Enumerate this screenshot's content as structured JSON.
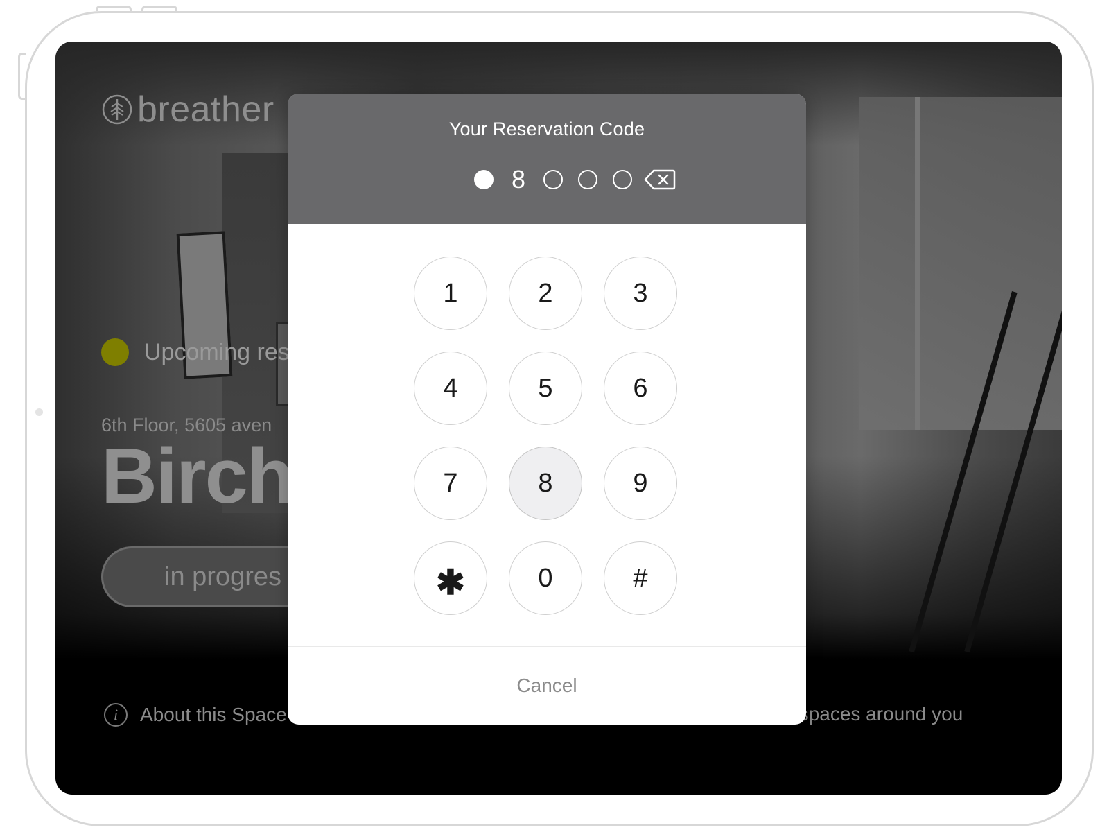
{
  "app": {
    "brand_name": "breather",
    "status_text": "Upcoming res",
    "status_color": "#7f7f00",
    "address": "6th Floor, 5605 aven",
    "space_name": "Birch",
    "progress_label": "in progres",
    "about_label": "About this Space",
    "other_spaces_label": "er spaces around you"
  },
  "modal": {
    "title": "Your Reservation Code",
    "code_slots": [
      {
        "state": "filled"
      },
      {
        "state": "digit",
        "value": "8"
      },
      {
        "state": "empty"
      },
      {
        "state": "empty"
      },
      {
        "state": "empty"
      }
    ],
    "backspace_icon": "backspace-icon",
    "keypad": [
      {
        "label": "1",
        "name": "key-1"
      },
      {
        "label": "2",
        "name": "key-2"
      },
      {
        "label": "3",
        "name": "key-3"
      },
      {
        "label": "4",
        "name": "key-4"
      },
      {
        "label": "5",
        "name": "key-5"
      },
      {
        "label": "6",
        "name": "key-6"
      },
      {
        "label": "7",
        "name": "key-7"
      },
      {
        "label": "8",
        "name": "key-8",
        "active": true
      },
      {
        "label": "9",
        "name": "key-9"
      },
      {
        "label": "✱",
        "name": "key-star"
      },
      {
        "label": "0",
        "name": "key-0"
      },
      {
        "label": "#",
        "name": "key-hash"
      }
    ],
    "cancel_label": "Cancel"
  }
}
